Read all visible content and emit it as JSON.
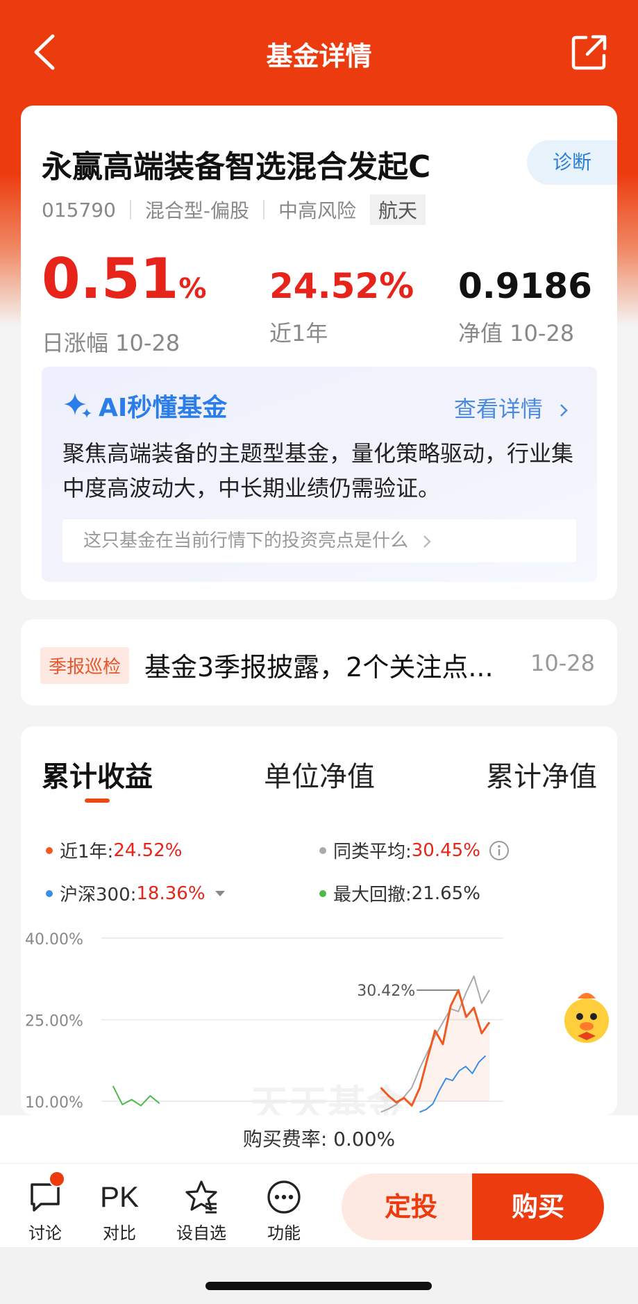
{
  "nav": {
    "title": "基金详情"
  },
  "fund": {
    "name": "永赢高端装备智选混合发起C",
    "diagnose_label": "诊断",
    "code": "015790",
    "type": "混合型-偏股",
    "risk": "中高风险",
    "tag": "航天",
    "daily_change": "0.51",
    "daily_change_unit": "%",
    "daily_change_label": "日涨幅 10-28",
    "year_return": "24.52%",
    "year_return_label": "近1年",
    "nav_value": "0.9186",
    "nav_label": "净值 10-28"
  },
  "ai": {
    "title": "AI秒懂基金",
    "more": "查看详情",
    "description": "聚焦高端装备的主题型基金，量化策略驱动，行业集中度高波动大，中长期业绩仍需验证。",
    "question": "这只基金在当前行情下的投资亮点是什么"
  },
  "news": {
    "tag": "季报巡检",
    "text": "基金3季报披露，2个关注点...",
    "date": "10-28"
  },
  "chart_tabs": [
    "累计收益",
    "单位净值",
    "累计净值"
  ],
  "legend": {
    "fund_label": "近1年:",
    "fund_value": "24.52%",
    "peer_label": "同类平均:",
    "peer_value": "30.45%",
    "index_label": "沪深300:",
    "index_value": "18.36%",
    "drawdown_label": "最大回撤:",
    "drawdown_value": "21.65%"
  },
  "colors": {
    "brand": "#ec3c0f",
    "rise": "#e62419",
    "fund_line": "#f05a22",
    "peer_line": "#aaaaaa",
    "index_line": "#3a8ee6",
    "drawdown_line": "#4cba4a"
  },
  "chart_data": {
    "type": "line",
    "yticks": [
      "40.00%",
      "25.00%",
      "10.00%"
    ],
    "ylim": [
      10,
      40
    ],
    "annotation": "30.42%",
    "series": [
      {
        "name": "近1年",
        "values": [
          12.5,
          11.0,
          9.8,
          10.6,
          9.2,
          12.4,
          17.8,
          23.0,
          20.5,
          27.5,
          30.42,
          25.5,
          27.2,
          22.5,
          24.52
        ]
      },
      {
        "name": "同类平均",
        "values": [
          8.0,
          8.6,
          9.4,
          10.8,
          12.5,
          16.0,
          19.0,
          22.0,
          24.5,
          27.0,
          26.5,
          30.0,
          33.0,
          28.0,
          30.45
        ]
      },
      {
        "name": "沪深300",
        "values": [
          8.0,
          8.5,
          9.5,
          12.0,
          14.2,
          13.8,
          15.6,
          16.4,
          15.1,
          17.2,
          18.36
        ]
      },
      {
        "name": "最大回撤",
        "values": [
          12.8,
          9.4,
          10.3,
          9.2,
          11.0,
          9.6
        ]
      }
    ],
    "grid": true
  },
  "footer": {
    "fee_text": "购买费率: 0.00%",
    "discuss": "讨论",
    "pk": "PK",
    "compare": "对比",
    "watch": "设自选",
    "func": "功能",
    "fixed_invest": "定投",
    "buy": "购买"
  }
}
